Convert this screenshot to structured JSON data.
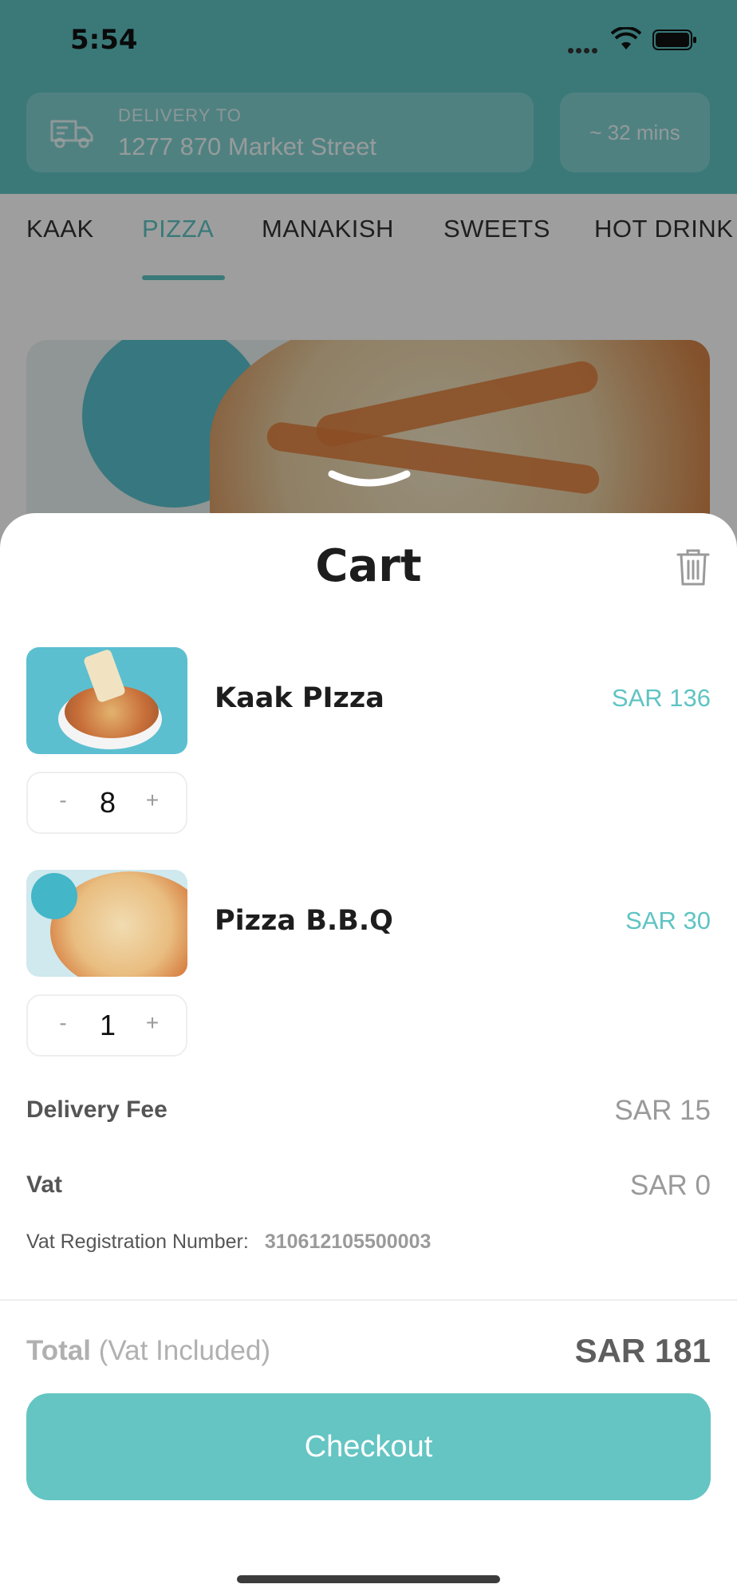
{
  "status_bar": {
    "time": "5:54"
  },
  "header": {
    "delivery_label": "DELIVERY TO",
    "address": "1277 870 Market Street",
    "eta": "~ 32 mins"
  },
  "categories": [
    {
      "label": "KAAK",
      "active": false
    },
    {
      "label": "PIZZA",
      "active": true
    },
    {
      "label": "MANAKISH",
      "active": false
    },
    {
      "label": "SWEETS",
      "active": false
    },
    {
      "label": "HOT DRINK",
      "active": false
    }
  ],
  "cart": {
    "title": "Cart",
    "items": [
      {
        "name": "Kaak PIzza",
        "price": "SAR 136",
        "quantity": "8",
        "minus": "-",
        "plus": "+"
      },
      {
        "name": "Pizza B.B.Q",
        "price": "SAR 30",
        "quantity": "1",
        "minus": "-",
        "plus": "+"
      }
    ],
    "delivery_fee": {
      "label": "Delivery Fee",
      "value": "SAR 15"
    },
    "vat": {
      "label": "Vat",
      "value": "SAR 0"
    },
    "vat_registration": {
      "label": "Vat Registration Number:",
      "number": "310612105500003"
    },
    "total": {
      "label": "Total",
      "note": "(Vat Included)",
      "value": "SAR 181"
    },
    "checkout_label": "Checkout"
  },
  "colors": {
    "accent": "#5fc4c3",
    "button": "#64c5c3"
  },
  "icons": [
    "truck-icon",
    "trash-icon",
    "chevron-down-icon",
    "wifi-icon",
    "battery-icon"
  ]
}
